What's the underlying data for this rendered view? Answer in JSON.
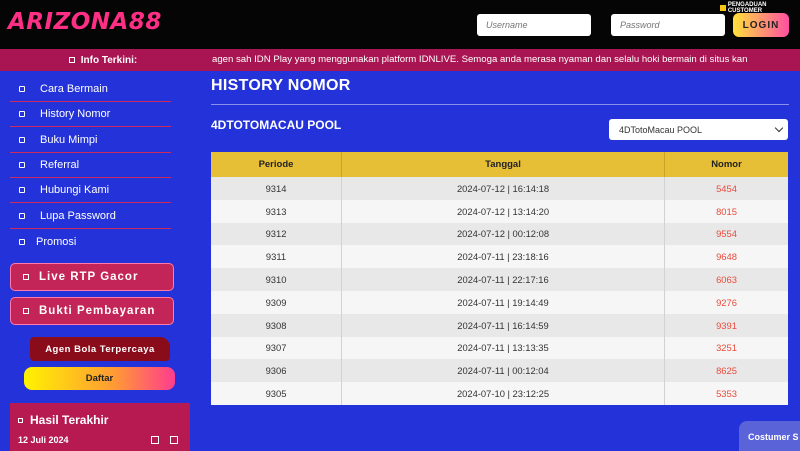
{
  "header": {
    "logo": "ARIZONA88",
    "pengaduan": "PENGADUAN CUSTOMER",
    "username_placeholder": "Username",
    "password_placeholder": "Password",
    "login_label": "LOGIN"
  },
  "ticker": {
    "label": "Info Terkini:",
    "text": "agen sah IDN Play yang menggunakan platform IDNLIVE. Semoga anda merasa nyaman dan selalu hoki bermain di situs kan"
  },
  "sidebar": {
    "items": [
      {
        "label": "Cara Bermain"
      },
      {
        "label": "History Nomor"
      },
      {
        "label": "Buku Mimpi"
      },
      {
        "label": "Referral"
      },
      {
        "label": "Hubungi Kami"
      },
      {
        "label": "Lupa Password"
      },
      {
        "label": "Promosi"
      }
    ],
    "live_rtp": "Live RTP Gacor",
    "bukti": "Bukti Pembayaran",
    "agen": "Agen Bola Terpercaya",
    "daftar": "Daftar",
    "hasil_title": "Hasil Terakhir",
    "hasil_date": "12 Juli 2024"
  },
  "main": {
    "title": "HISTORY NOMOR",
    "pool_title": "4DTOTOMACAU POOL",
    "select_value": "4DTotoMacau POOL",
    "table": {
      "headers": [
        "Periode",
        "Tanggal",
        "Nomor"
      ],
      "rows": [
        [
          "9314",
          "2024-07-12 | 16:14:18",
          "5454"
        ],
        [
          "9313",
          "2024-07-12 | 13:14:20",
          "8015"
        ],
        [
          "9312",
          "2024-07-12 | 00:12:08",
          "9554"
        ],
        [
          "9311",
          "2024-07-11 | 23:18:16",
          "9648"
        ],
        [
          "9310",
          "2024-07-11 | 22:17:16",
          "6063"
        ],
        [
          "9309",
          "2024-07-11 | 19:14:49",
          "9276"
        ],
        [
          "9308",
          "2024-07-11 | 16:14:59",
          "9391"
        ],
        [
          "9307",
          "2024-07-11 | 13:13:35",
          "3251"
        ],
        [
          "9306",
          "2024-07-11 | 00:12:04",
          "8625"
        ],
        [
          "9305",
          "2024-07-10 | 23:12:25",
          "5353"
        ]
      ]
    }
  },
  "customer_button": "Costumer S",
  "colors": {
    "background": "#2433d9",
    "ticker": "#a81552",
    "table_header": "#e6bf36",
    "number": "#e94b3c"
  }
}
